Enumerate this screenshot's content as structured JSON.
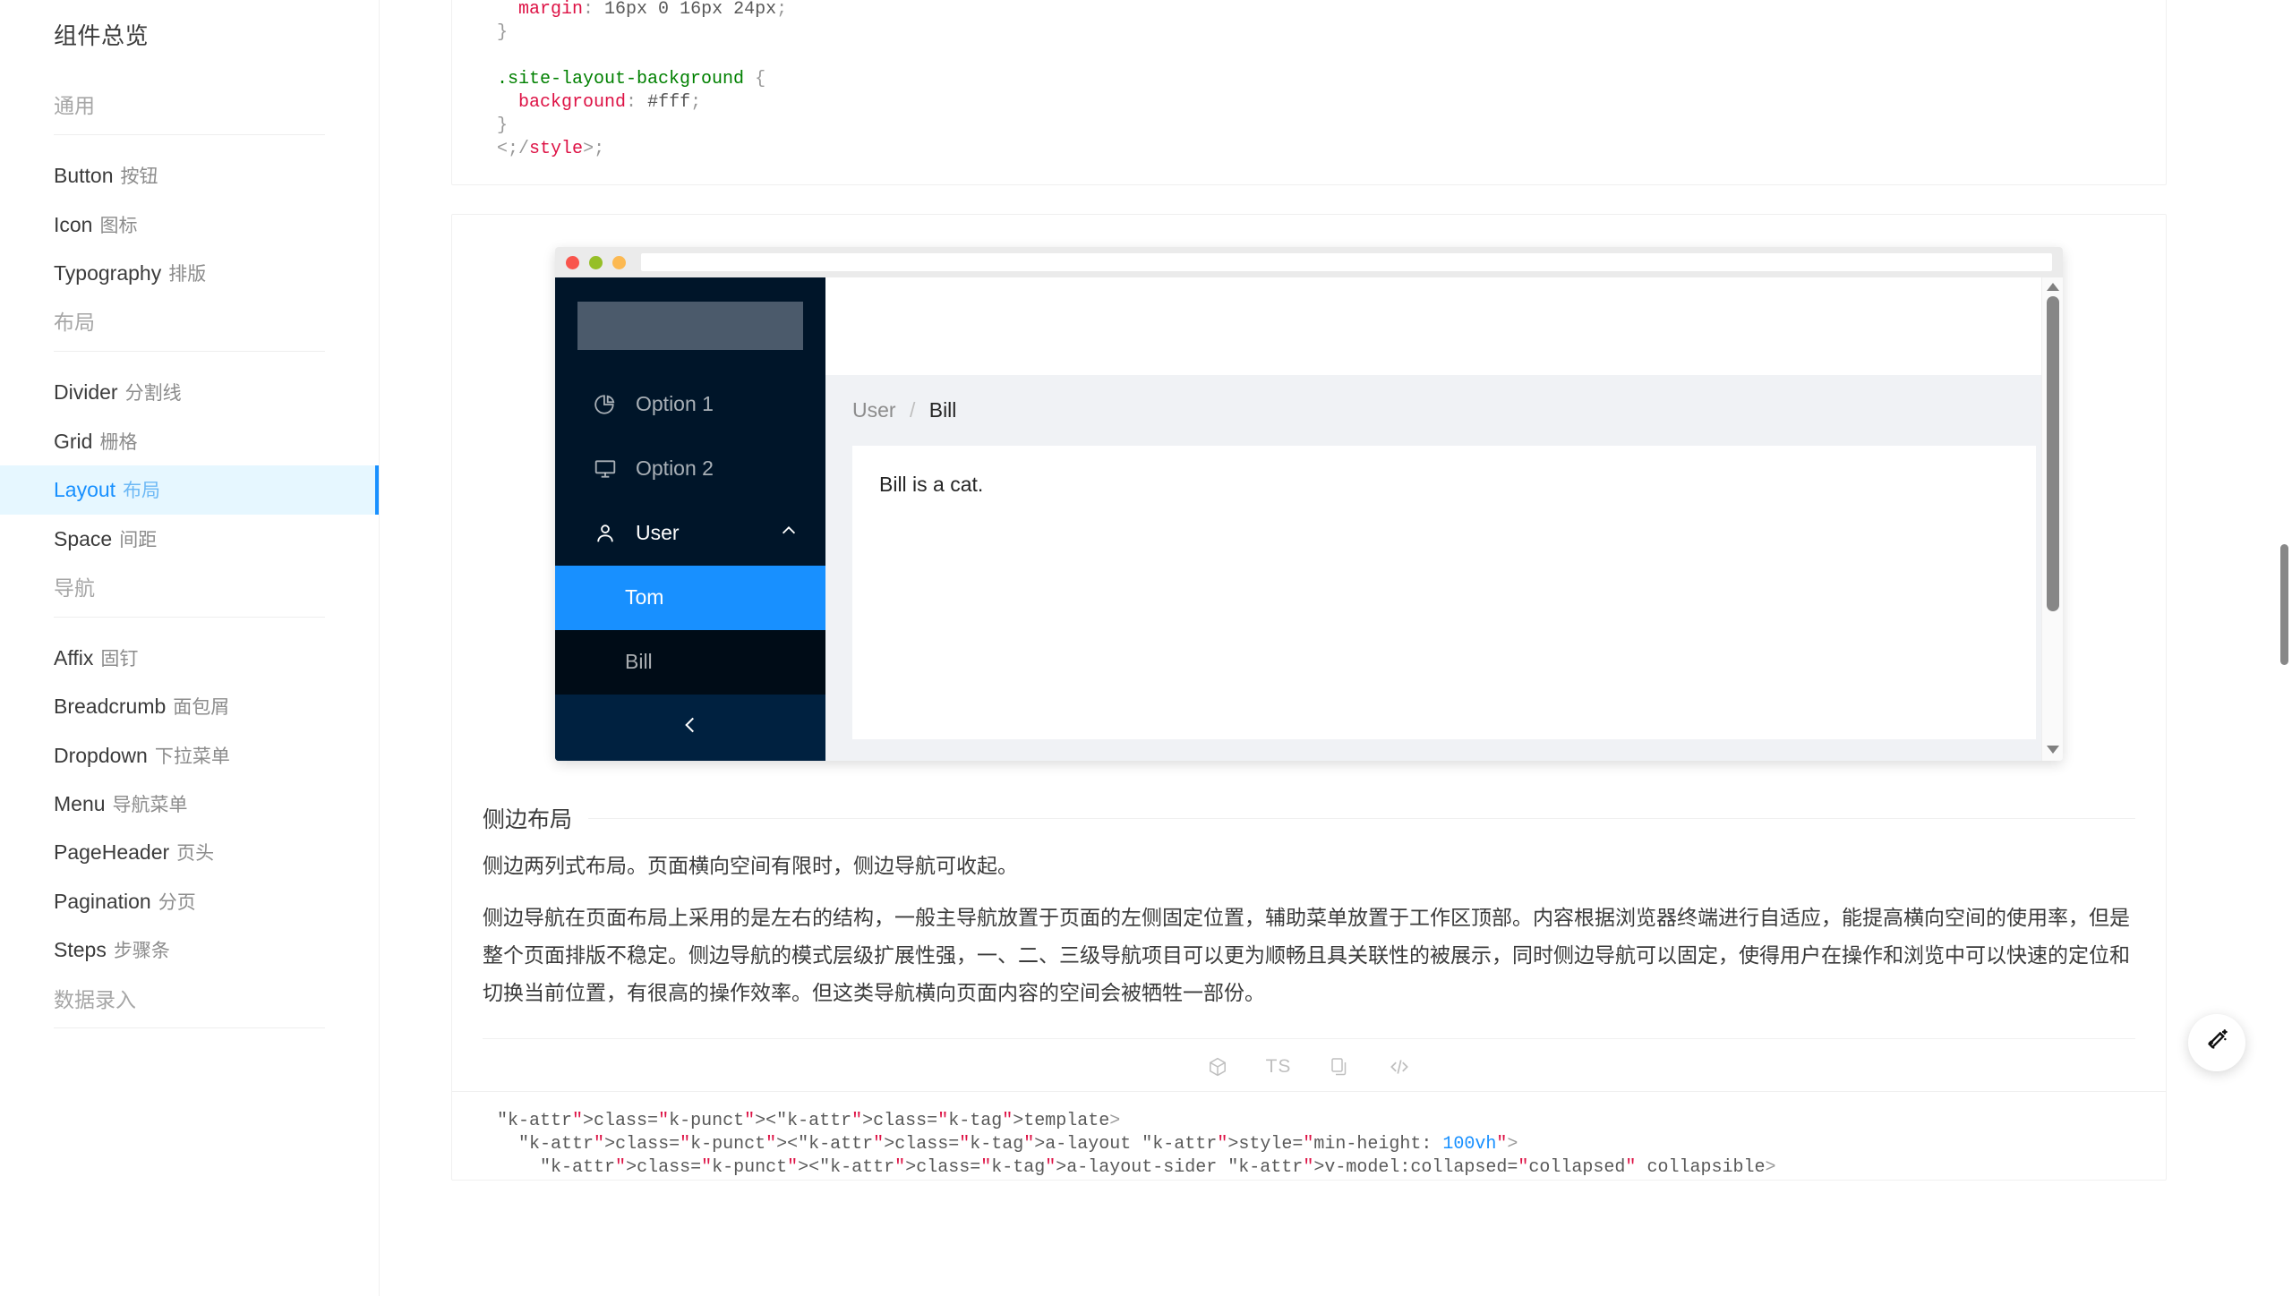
{
  "sidebar": {
    "title": "组件总览",
    "sections": [
      {
        "group": "通用",
        "items": [
          {
            "en": "Button",
            "cn": "按钮",
            "active": false
          },
          {
            "en": "Icon",
            "cn": "图标",
            "active": false
          },
          {
            "en": "Typography",
            "cn": "排版",
            "active": false
          }
        ]
      },
      {
        "group": "布局",
        "items": [
          {
            "en": "Divider",
            "cn": "分割线",
            "active": false
          },
          {
            "en": "Grid",
            "cn": "栅格",
            "active": false
          },
          {
            "en": "Layout",
            "cn": "布局",
            "active": true
          },
          {
            "en": "Space",
            "cn": "间距",
            "active": false
          }
        ]
      },
      {
        "group": "导航",
        "items": [
          {
            "en": "Affix",
            "cn": "固钉",
            "active": false
          },
          {
            "en": "Breadcrumb",
            "cn": "面包屑",
            "active": false
          },
          {
            "en": "Dropdown",
            "cn": "下拉菜单",
            "active": false
          },
          {
            "en": "Menu",
            "cn": "导航菜单",
            "active": false
          },
          {
            "en": "PageHeader",
            "cn": "页头",
            "active": false
          },
          {
            "en": "Pagination",
            "cn": "分页",
            "active": false
          },
          {
            "en": "Steps",
            "cn": "步骤条",
            "active": false
          }
        ]
      },
      {
        "group": "数据录入",
        "items": []
      }
    ]
  },
  "top_code": {
    "lines": [
      "  margin: 16px 0 16px 24px;",
      "}",
      "",
      ".site-layout-background {",
      "  background: #fff;",
      "}",
      "</style>"
    ]
  },
  "demo": {
    "browser": {
      "dots": [
        "close-red",
        "minimize-green",
        "maximize-yellow"
      ],
      "url_value": ""
    },
    "sider": {
      "logo_label": "",
      "menu": [
        {
          "label": "Option 1",
          "icon": "pie-chart-icon"
        },
        {
          "label": "Option 2",
          "icon": "desktop-icon"
        },
        {
          "label": "User",
          "icon": "user-icon",
          "caret": "chevron-up-icon",
          "open": true
        }
      ],
      "submenu": [
        {
          "label": "Tom",
          "selected": true
        },
        {
          "label": "Bill",
          "selected": false
        }
      ],
      "trigger_icon": "chevron-left-icon"
    },
    "content": {
      "breadcrumb": [
        "User",
        "Bill"
      ],
      "breadcrumb_separator": "/",
      "body_text": "Bill is a cat."
    }
  },
  "meta": {
    "title": "侧边布局",
    "paragraphs": [
      "侧边两列式布局。页面横向空间有限时，侧边导航可收起。",
      "侧边导航在页面布局上采用的是左右的结构，一般主导航放置于页面的左侧固定位置，辅助菜单放置于工作区顶部。内容根据浏览器终端进行自适应，能提高横向空间的使用率，但是整个页面排版不稳定。侧边导航的模式层级扩展性强，一、二、三级导航项目可以更为顺畅且具关联性的被展示，同时侧边导航可以固定，使得用户在操作和浏览中可以快速的定位和切换当前位置，有很高的操作效率。但这类导航横向页面内容的空间会被牺牲一部份。"
    ],
    "actions": [
      {
        "name": "codesandbox-icon",
        "label": ""
      },
      {
        "name": "typescript-icon",
        "label": "TS"
      },
      {
        "name": "copy-icon",
        "label": ""
      },
      {
        "name": "code-icon",
        "label": ""
      }
    ]
  },
  "bottom_code": {
    "lines": [
      "<template>",
      "  <a-layout style=\"min-height: 100vh\">",
      "    <a-layout-sider v-model:collapsed=\"collapsed\" collapsible>"
    ]
  },
  "fab": {
    "icon": "magic-wand-icon"
  },
  "colors": {
    "accent": "#1890ff",
    "accent_bg": "#e6f7ff",
    "sider_dark": "#001529",
    "submenu_dark": "#000c17",
    "trigger_dark": "#002140",
    "demo_bg": "#f0f2f5",
    "logo_placeholder": "#4b5a6b"
  }
}
